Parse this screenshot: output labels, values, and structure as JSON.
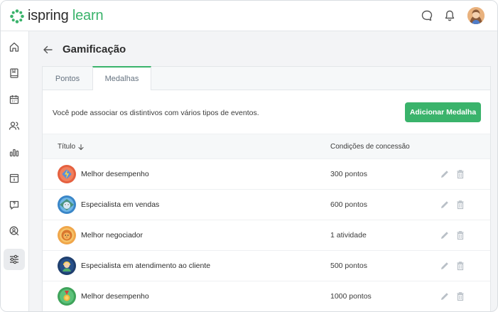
{
  "app": {
    "logo_text_primary": "ispring",
    "logo_text_secondary": "learn",
    "brand_color": "#3ab36b"
  },
  "topbar": {
    "icons": [
      "chat-icon",
      "bell-icon"
    ],
    "avatar": "user-avatar"
  },
  "sidebar": {
    "items": [
      {
        "name": "home-icon"
      },
      {
        "name": "book-icon"
      },
      {
        "name": "calendar-icon"
      },
      {
        "name": "users-icon"
      },
      {
        "name": "bar-chart-icon"
      },
      {
        "name": "info-box-icon"
      },
      {
        "name": "question-icon"
      },
      {
        "name": "user-search-icon"
      },
      {
        "name": "sliders-icon",
        "active": true
      }
    ]
  },
  "page": {
    "title": "Gamificação"
  },
  "tabs": [
    {
      "label": "Pontos",
      "active": false
    },
    {
      "label": "Medalhas",
      "active": true
    }
  ],
  "content": {
    "description": "Você pode associar os distintivos com vários tipos de eventos.",
    "add_button": "Adicionar Medalha"
  },
  "table": {
    "columns": {
      "title": "Título",
      "conditions": "Condições de concessão"
    },
    "rows": [
      {
        "title": "Melhor desempenho",
        "condition": "300 pontos",
        "badge": "lightning-badge"
      },
      {
        "title": "Especialista em vendas",
        "condition": "600 pontos",
        "badge": "owl-badge"
      },
      {
        "title": "Melhor negociador",
        "condition": "1 atividade",
        "badge": "lion-badge"
      },
      {
        "title": "Especialista em atendimento ao cliente",
        "condition": "500 pontos",
        "badge": "headset-badge"
      },
      {
        "title": "Melhor desempenho",
        "condition": "1000 pontos",
        "badge": "medal-badge"
      }
    ]
  }
}
